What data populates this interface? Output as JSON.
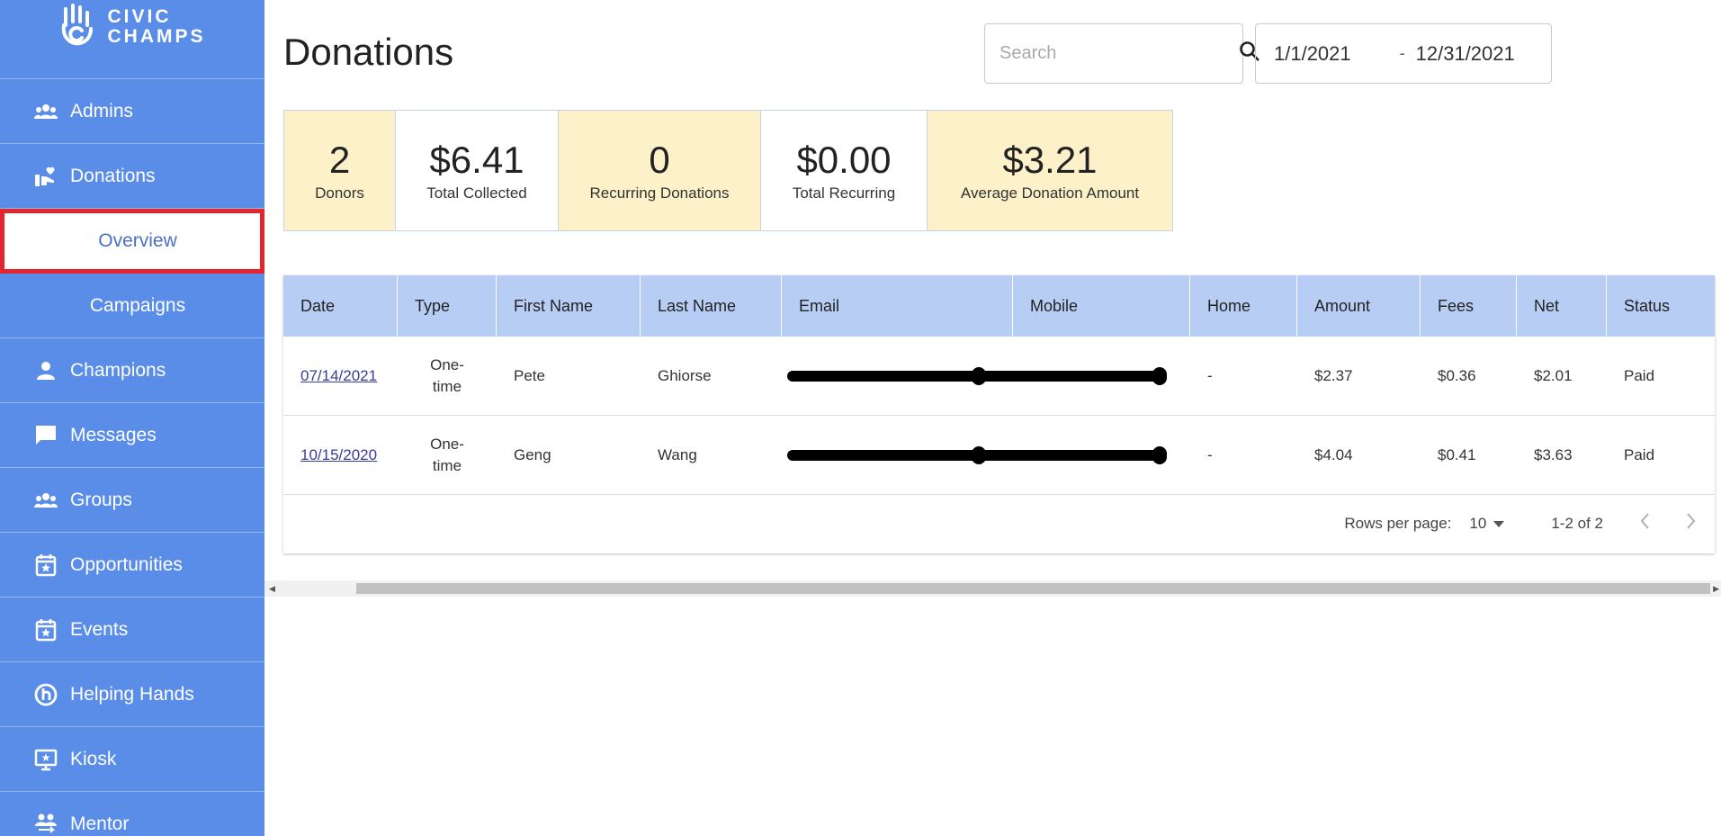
{
  "brand": {
    "line1": "CIVIC",
    "line2": "CHAMPS"
  },
  "colors": {
    "sidebar": "#5a8de8",
    "header_row": "#b8cdf4",
    "card_yellow": "#fdf1c9",
    "highlight": "#e3262e"
  },
  "sidebar": {
    "items": [
      {
        "label": "Admins",
        "icon": "group-icon"
      },
      {
        "label": "Donations",
        "icon": "hand-heart-icon"
      },
      {
        "label": "Overview",
        "sub": true,
        "active": true
      },
      {
        "label": "Campaigns",
        "sub": true
      },
      {
        "label": "Champions",
        "icon": "person-icon"
      },
      {
        "label": "Messages",
        "icon": "chat-icon"
      },
      {
        "label": "Groups",
        "icon": "group-icon"
      },
      {
        "label": "Opportunities",
        "icon": "calendar-star-icon"
      },
      {
        "label": "Events",
        "icon": "calendar-star-icon"
      },
      {
        "label": "Helping Hands",
        "icon": "helping-hands-icon"
      },
      {
        "label": "Kiosk",
        "icon": "kiosk-icon"
      },
      {
        "label": "Mentor",
        "icon": "mentor-icon"
      }
    ]
  },
  "page": {
    "title": "Donations"
  },
  "search": {
    "placeholder": "Search",
    "value": ""
  },
  "date_range": {
    "start": "1/1/2021",
    "separator": "-",
    "end": "12/31/2021"
  },
  "stats": [
    {
      "value": "2",
      "label": "Donors"
    },
    {
      "value": "$6.41",
      "label": "Total Collected"
    },
    {
      "value": "0",
      "label": "Recurring Donations"
    },
    {
      "value": "$0.00",
      "label": "Total Recurring"
    },
    {
      "value": "$3.21",
      "label": "Average Donation Amount"
    }
  ],
  "table": {
    "columns": [
      "Date",
      "Type",
      "First Name",
      "Last Name",
      "Email",
      "Mobile",
      "Home",
      "Amount",
      "Fees",
      "Net",
      "Status"
    ],
    "rows": [
      {
        "date": "07/14/2021",
        "type1": "One-",
        "type2": "time",
        "first": "Pete",
        "last": "Ghiorse",
        "email": "",
        "mobile": "",
        "home": "-",
        "amount": "$2.37",
        "fees": "$0.36",
        "net": "$2.01",
        "status": "Paid"
      },
      {
        "date": "10/15/2020",
        "type1": "One-",
        "type2": "time",
        "first": "Geng",
        "last": "Wang",
        "email": "",
        "mobile": "",
        "home": "-",
        "amount": "$4.04",
        "fees": "$0.41",
        "net": "$3.63",
        "status": "Paid"
      }
    ],
    "footer": {
      "rows_per_page_label": "Rows per page:",
      "rows_per_page": "10",
      "range": "1-2 of 2"
    }
  }
}
